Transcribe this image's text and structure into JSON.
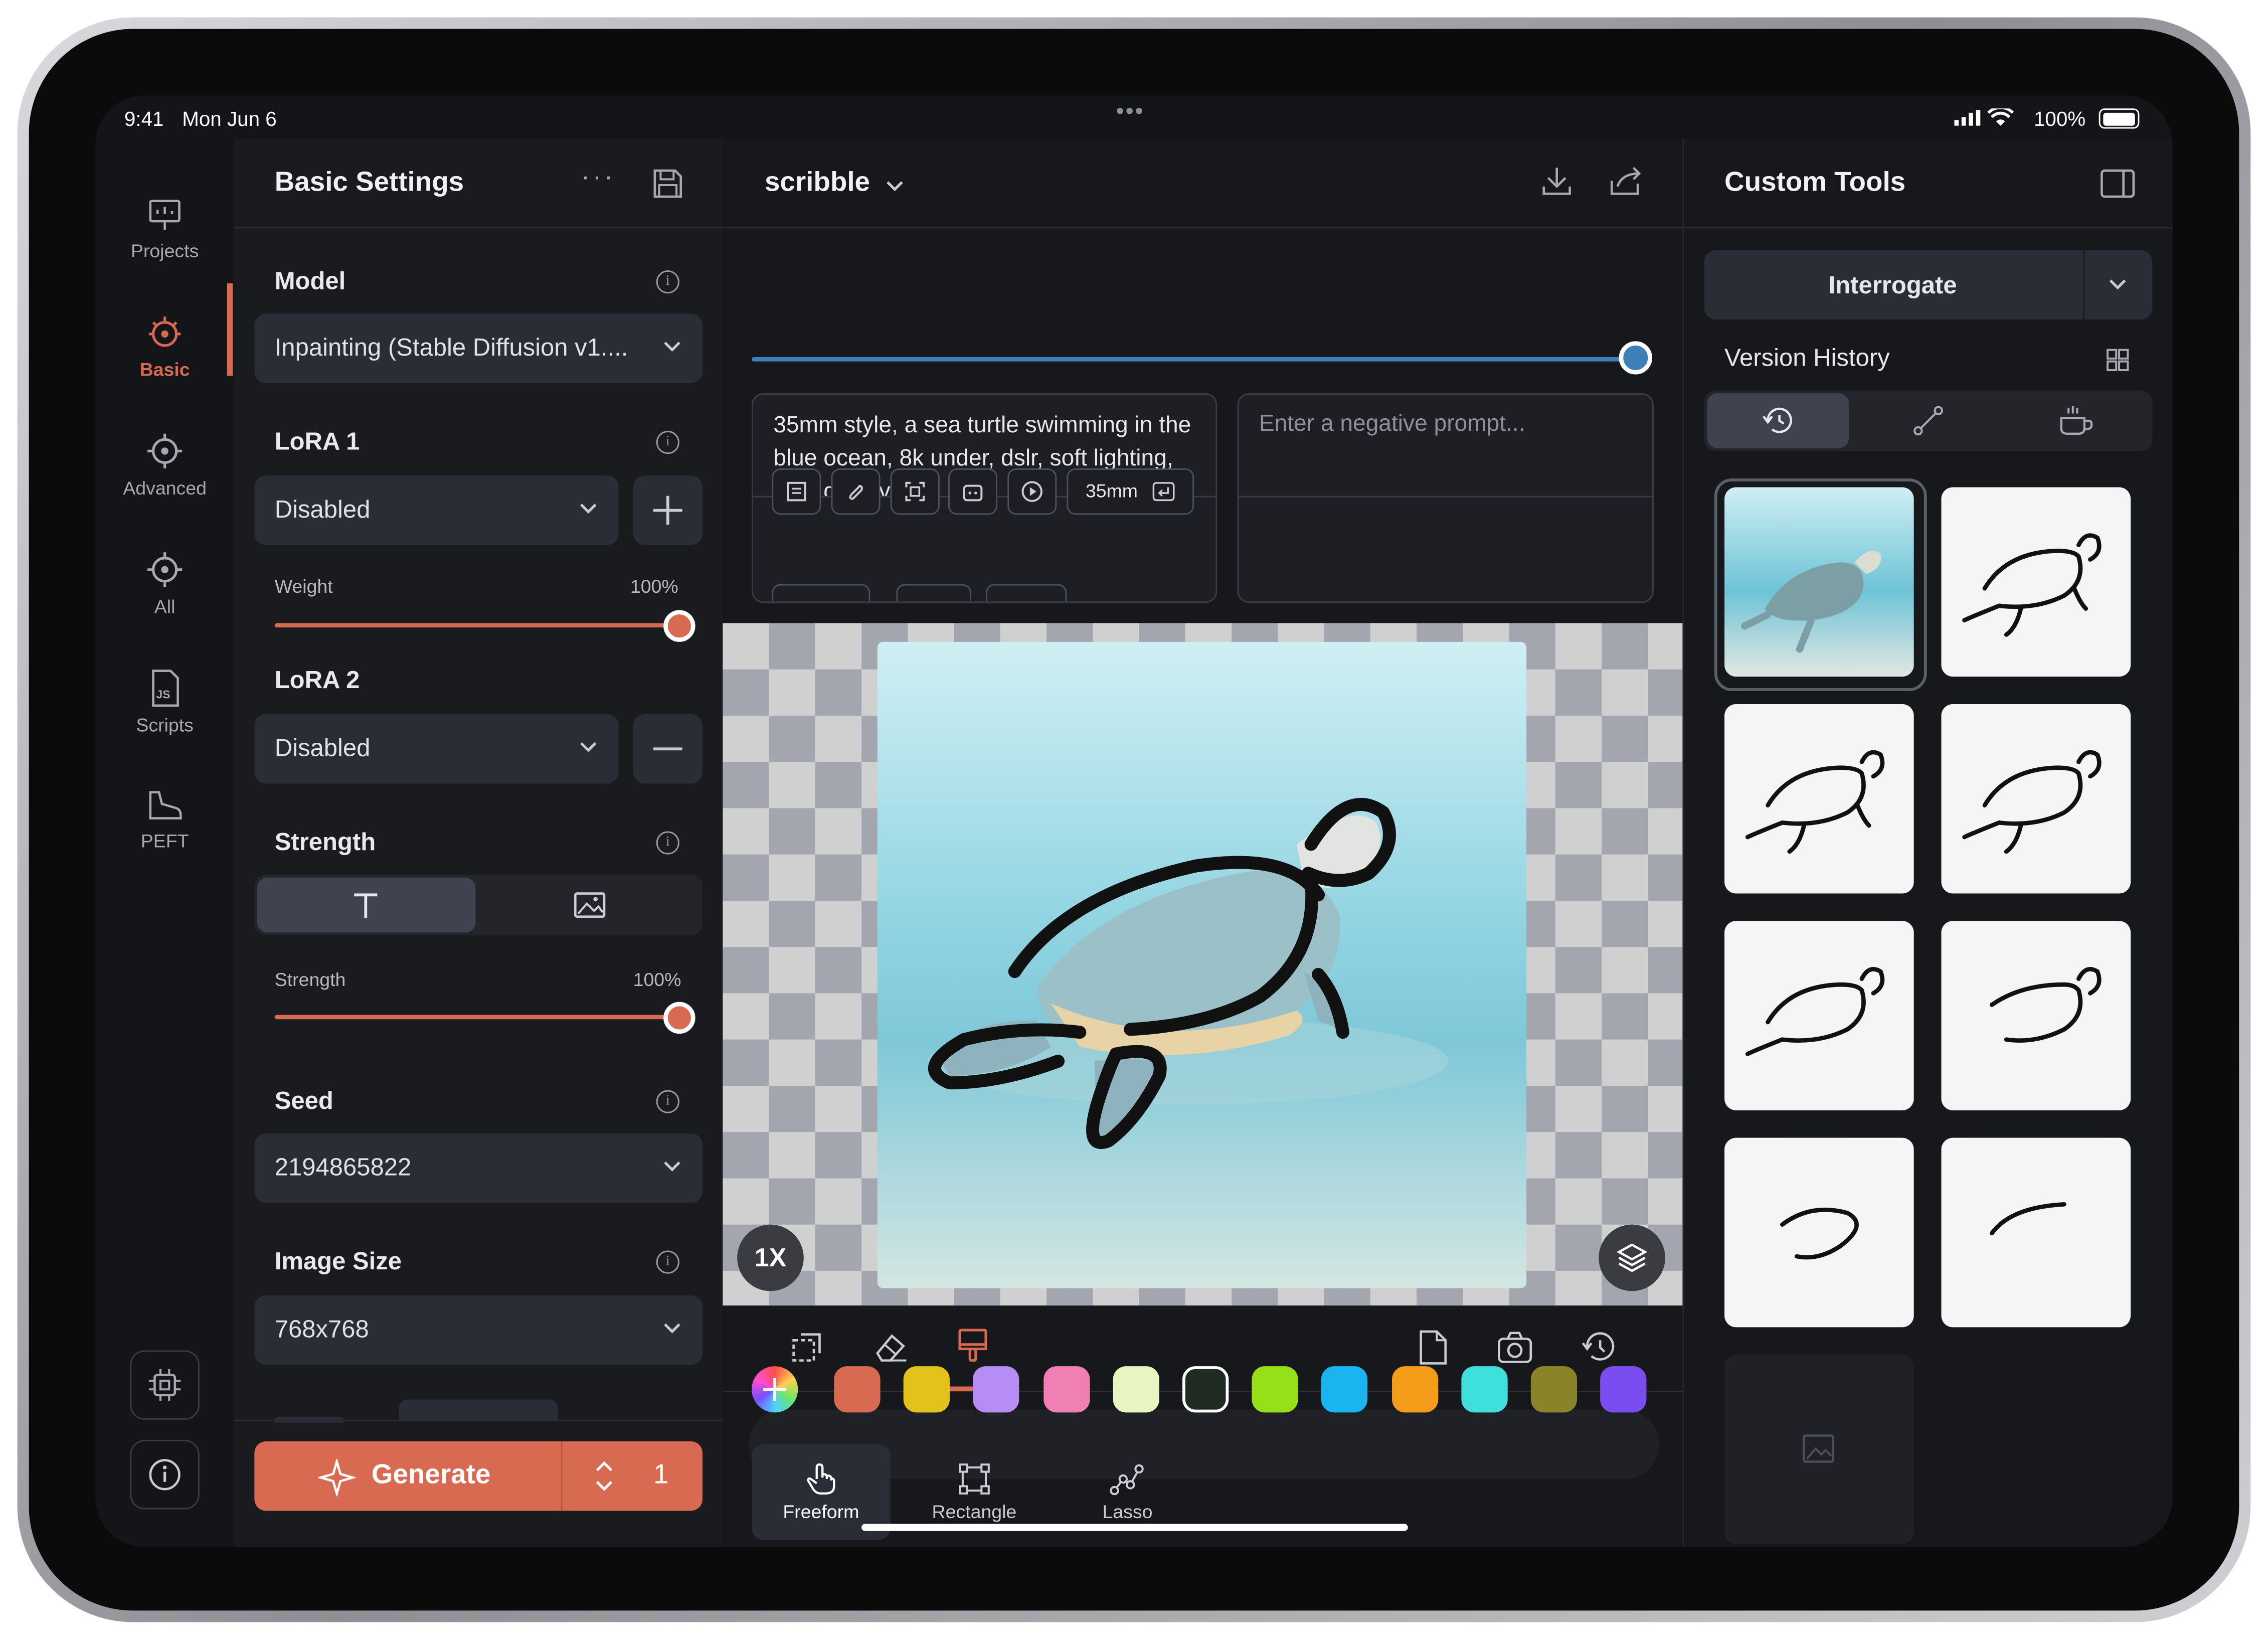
{
  "status_bar": {
    "time": "9:41",
    "date": "Mon Jun 6",
    "battery": "100%"
  },
  "rail": {
    "items": [
      {
        "label": "Projects",
        "icon": "presentation-icon"
      },
      {
        "label": "Basic",
        "icon": "sparkle-gear-icon",
        "active": true
      },
      {
        "label": "Advanced",
        "icon": "gear-icon"
      },
      {
        "label": "All",
        "icon": "gear-icon"
      },
      {
        "label": "Scripts",
        "icon": "js-file-icon"
      },
      {
        "label": "PEFT",
        "icon": "shoe-icon"
      }
    ]
  },
  "left_panel": {
    "title": "Basic Settings",
    "model": {
      "label": "Model",
      "value": "Inpainting (Stable Diffusion v1...."
    },
    "lora1": {
      "label": "LoRA 1",
      "value": "Disabled",
      "weight_label": "Weight",
      "weight_value": "100%",
      "weight_fraction": 1.0
    },
    "lora2": {
      "label": "LoRA 2",
      "value": "Disabled"
    },
    "strength": {
      "label": "Strength",
      "slider_label": "Strength",
      "slider_value": "100%",
      "fraction": 1.0
    },
    "seed": {
      "label": "Seed",
      "value": "2194865822"
    },
    "image_size": {
      "label": "Image Size",
      "value": "768x768"
    },
    "generate": {
      "label": "Generate",
      "count": "1"
    }
  },
  "center": {
    "script_name": "scribble",
    "prompt": "35mm style, a sea turtle swimming in the blue ocean, 8k under, dslr, soft lighting, high quality",
    "negative_placeholder": "Enter a negative prompt...",
    "chip_label": "35mm",
    "zoom": "1X",
    "colors": [
      "#d96a52",
      "#e3c31b",
      "#b68cf5",
      "#f07fb4",
      "#e7f5c2",
      "#1f2a22",
      "#96e01a",
      "#1ab5f0",
      "#f59c1a",
      "#3fe0dc",
      "#8a8428",
      "#7a4df0"
    ],
    "tools": [
      {
        "label": "Freeform",
        "icon": "hand-pointer-icon",
        "active": true
      },
      {
        "label": "Rectangle",
        "icon": "rectangle-select-icon"
      },
      {
        "label": "Lasso",
        "icon": "lasso-icon"
      }
    ]
  },
  "right_panel": {
    "title": "Custom Tools",
    "interrogate": "Interrogate",
    "version_history": "Version History"
  },
  "accent": "#d96a52"
}
